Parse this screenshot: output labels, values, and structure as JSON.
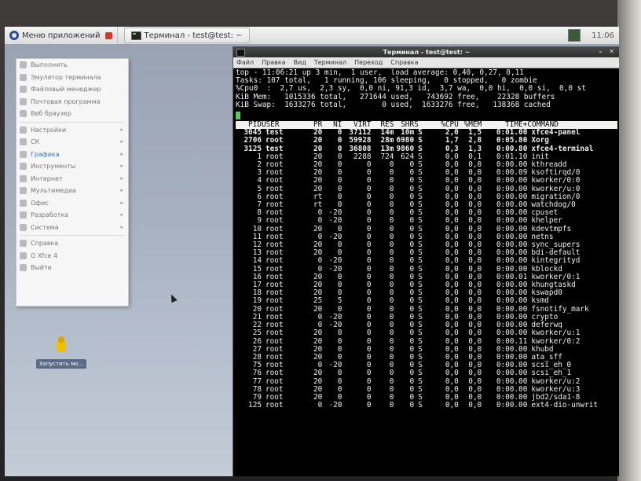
{
  "topbar": {
    "app_menu_label": "Меню приложений",
    "task_label": "Терминал - test@test: ~",
    "clock": "11:06"
  },
  "app_menu": {
    "items": [
      {
        "label": "Выполнить",
        "icon": "run-icon",
        "submenu": false
      },
      {
        "label": "Эмулятор терминала",
        "icon": "terminal-icon",
        "submenu": false
      },
      {
        "label": "Файловый менеджер",
        "icon": "folder-icon",
        "submenu": false
      },
      {
        "label": "Почтовая программа",
        "icon": "mail-icon",
        "submenu": false
      },
      {
        "label": "Веб браузер",
        "icon": "globe-icon",
        "submenu": false
      },
      {
        "label": "Настройки",
        "icon": "settings-icon",
        "submenu": true
      },
      {
        "label": "СК",
        "icon": "system-icon",
        "submenu": true
      },
      {
        "label": "Графика",
        "icon": "graphics-icon",
        "submenu": true
      },
      {
        "label": "Инструменты",
        "icon": "tools-icon",
        "submenu": true
      },
      {
        "label": "Интернет",
        "icon": "internet-icon",
        "submenu": true
      },
      {
        "label": "Мультимедиа",
        "icon": "multimedia-icon",
        "submenu": true
      },
      {
        "label": "Офис",
        "icon": "office-icon",
        "submenu": true
      },
      {
        "label": "Разработка",
        "icon": "development-icon",
        "submenu": true
      },
      {
        "label": "Система",
        "icon": "system-gear-icon",
        "submenu": true
      },
      {
        "label": "Справка",
        "icon": "help-icon",
        "submenu": false
      },
      {
        "label": "О Xfce 4",
        "icon": "info-icon",
        "submenu": false
      },
      {
        "label": "Выйти",
        "icon": "logout-icon",
        "submenu": false
      }
    ]
  },
  "desktop_icon": {
    "label": "Запустить мо..."
  },
  "terminal": {
    "title": "Терминал - test@test: ~",
    "menu": [
      "Файл",
      "Правка",
      "Вид",
      "Терминал",
      "Переход",
      "Справка"
    ],
    "summary": [
      "top - 11:06:21 up 3 min,  1 user,  load average: 0,40, 0,27, 0,11",
      "Tasks: 107 total,   1 running, 106 sleeping,   0 stopped,   0 zombie",
      "%Cpu0  :  2,7 us,  2,3 sy,  0,0 ni, 91,3 id,  3,7 wa,  0,0 hi,  0,0 si,  0,0 st",
      "KiB Mem:   1015336 total,   271644 used,   743692 free,    22328 buffers",
      "KiB Swap:  1633276 total,        0 used,  1633276 free,   138368 cached"
    ],
    "columns": [
      "PID",
      "USER",
      "PR",
      "NI",
      "VIRT",
      "RES",
      "SHR",
      "S",
      "%CPU",
      "%MEM",
      "TIME+",
      "COMMAND"
    ],
    "rows": [
      [
        "3045",
        "test",
        "20",
        "0",
        "37112",
        "14m",
        "10m",
        "S",
        "2,0",
        "1,5",
        "0:01.00",
        "xfce4-panel"
      ],
      [
        "2706",
        "root",
        "20",
        "0",
        "59928",
        "28m",
        "6980",
        "S",
        "1,7",
        "2,8",
        "0:05.80",
        "Xorg"
      ],
      [
        "3125",
        "test",
        "20",
        "0",
        "36808",
        "13m",
        "9860",
        "S",
        "0,3",
        "1,3",
        "0:00.80",
        "xfce4-terminal"
      ],
      [
        "1",
        "root",
        "20",
        "0",
        "2288",
        "724",
        "624",
        "S",
        "0,0",
        "0,1",
        "0:01.10",
        "init"
      ],
      [
        "2",
        "root",
        "20",
        "0",
        "0",
        "0",
        "0",
        "S",
        "0,0",
        "0,0",
        "0:00.00",
        "kthreadd"
      ],
      [
        "3",
        "root",
        "20",
        "0",
        "0",
        "0",
        "0",
        "S",
        "0,0",
        "0,0",
        "0:00.09",
        "ksoftirqd/0"
      ],
      [
        "4",
        "root",
        "20",
        "0",
        "0",
        "0",
        "0",
        "S",
        "0,0",
        "0,0",
        "0:00.00",
        "kworker/0:0"
      ],
      [
        "5",
        "root",
        "20",
        "0",
        "0",
        "0",
        "0",
        "S",
        "0,0",
        "0,0",
        "0:00.00",
        "kworker/u:0"
      ],
      [
        "6",
        "root",
        "rt",
        "0",
        "0",
        "0",
        "0",
        "S",
        "0,0",
        "0,0",
        "0:00.00",
        "migration/0"
      ],
      [
        "7",
        "root",
        "rt",
        "0",
        "0",
        "0",
        "0",
        "S",
        "0,0",
        "0,0",
        "0:00.00",
        "watchdog/0"
      ],
      [
        "8",
        "root",
        "0",
        "-20",
        "0",
        "0",
        "0",
        "S",
        "0,0",
        "0,0",
        "0:00.00",
        "cpuset"
      ],
      [
        "9",
        "root",
        "0",
        "-20",
        "0",
        "0",
        "0",
        "S",
        "0,0",
        "0,0",
        "0:00.00",
        "khelper"
      ],
      [
        "10",
        "root",
        "20",
        "0",
        "0",
        "0",
        "0",
        "S",
        "0,0",
        "0,0",
        "0:00.00",
        "kdevtmpfs"
      ],
      [
        "11",
        "root",
        "0",
        "-20",
        "0",
        "0",
        "0",
        "S",
        "0,0",
        "0,0",
        "0:00.00",
        "netns"
      ],
      [
        "12",
        "root",
        "20",
        "0",
        "0",
        "0",
        "0",
        "S",
        "0,0",
        "0,0",
        "0:00.00",
        "sync_supers"
      ],
      [
        "13",
        "root",
        "20",
        "0",
        "0",
        "0",
        "0",
        "S",
        "0,0",
        "0,0",
        "0:00.00",
        "bdi-default"
      ],
      [
        "14",
        "root",
        "0",
        "-20",
        "0",
        "0",
        "0",
        "S",
        "0,0",
        "0,0",
        "0:00.00",
        "kintegrityd"
      ],
      [
        "15",
        "root",
        "0",
        "-20",
        "0",
        "0",
        "0",
        "S",
        "0,0",
        "0,0",
        "0:00.00",
        "kblockd"
      ],
      [
        "16",
        "root",
        "20",
        "0",
        "0",
        "0",
        "0",
        "S",
        "0,0",
        "0,0",
        "0:00.01",
        "kworker/0:1"
      ],
      [
        "17",
        "root",
        "20",
        "0",
        "0",
        "0",
        "0",
        "S",
        "0,0",
        "0,0",
        "0:00.00",
        "khungtaskd"
      ],
      [
        "18",
        "root",
        "20",
        "0",
        "0",
        "0",
        "0",
        "S",
        "0,0",
        "0,0",
        "0:00.00",
        "kswapd0"
      ],
      [
        "19",
        "root",
        "25",
        "5",
        "0",
        "0",
        "0",
        "S",
        "0,0",
        "0,0",
        "0:00.00",
        "ksmd"
      ],
      [
        "20",
        "root",
        "20",
        "0",
        "0",
        "0",
        "0",
        "S",
        "0,0",
        "0,0",
        "0:00.00",
        "fsnotify_mark"
      ],
      [
        "21",
        "root",
        "0",
        "-20",
        "0",
        "0",
        "0",
        "S",
        "0,0",
        "0,0",
        "0:00.00",
        "crypto"
      ],
      [
        "22",
        "root",
        "0",
        "-20",
        "0",
        "0",
        "0",
        "S",
        "0,0",
        "0,0",
        "0:00.00",
        "deferwq"
      ],
      [
        "25",
        "root",
        "20",
        "0",
        "0",
        "0",
        "0",
        "S",
        "0,0",
        "0,0",
        "0:00.00",
        "kworker/u:1"
      ],
      [
        "26",
        "root",
        "20",
        "0",
        "0",
        "0",
        "0",
        "S",
        "0,0",
        "0,0",
        "0:00.11",
        "kworker/0:2"
      ],
      [
        "27",
        "root",
        "20",
        "0",
        "0",
        "0",
        "0",
        "S",
        "0,0",
        "0,0",
        "0:00.00",
        "khubd"
      ],
      [
        "28",
        "root",
        "20",
        "0",
        "0",
        "0",
        "0",
        "S",
        "0,0",
        "0,0",
        "0:00.00",
        "ata_sff"
      ],
      [
        "75",
        "root",
        "0",
        "-20",
        "0",
        "0",
        "0",
        "S",
        "0,0",
        "0,0",
        "0:00.00",
        "scsi_eh_0"
      ],
      [
        "76",
        "root",
        "20",
        "0",
        "0",
        "0",
        "0",
        "S",
        "0,0",
        "0,0",
        "0:00.00",
        "scsi_eh_1"
      ],
      [
        "77",
        "root",
        "20",
        "0",
        "0",
        "0",
        "0",
        "S",
        "0,0",
        "0,0",
        "0:00.00",
        "kworker/u:2"
      ],
      [
        "78",
        "root",
        "20",
        "0",
        "0",
        "0",
        "0",
        "S",
        "0,0",
        "0,0",
        "0:00.00",
        "kworker/u:3"
      ],
      [
        "79",
        "root",
        "20",
        "0",
        "0",
        "0",
        "0",
        "S",
        "0,0",
        "0,0",
        "0:00.00",
        "jbd2/sda1-8"
      ],
      [
        "125",
        "root",
        "0",
        "-20",
        "0",
        "0",
        "0",
        "S",
        "0,0",
        "0,0",
        "0:00.00",
        "ext4-dio-unwrit"
      ]
    ]
  }
}
